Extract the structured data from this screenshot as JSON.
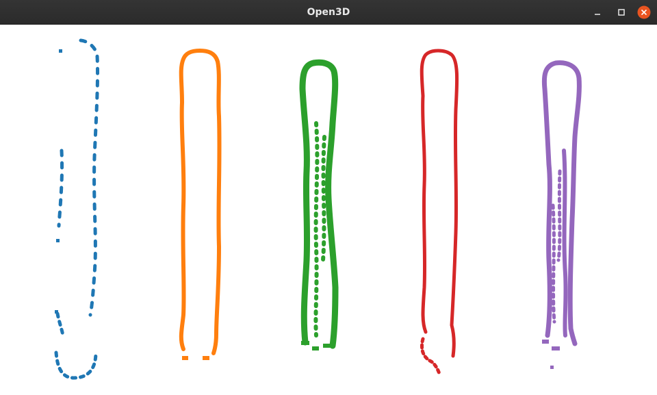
{
  "window": {
    "title": "Open3D",
    "buttons": {
      "minimize_icon": "minimize-icon",
      "maximize_icon": "maximize-icon",
      "close_icon": "close-icon"
    },
    "close_color": "#e95420"
  },
  "viewport": {
    "background": "#ffffff",
    "objects": [
      {
        "name": "outline-blue",
        "color": "#1f77b4"
      },
      {
        "name": "outline-orange",
        "color": "#ff7f0e"
      },
      {
        "name": "outline-green",
        "color": "#2ca02c"
      },
      {
        "name": "outline-red",
        "color": "#d62728"
      },
      {
        "name": "outline-purple",
        "color": "#9467bd"
      }
    ]
  }
}
